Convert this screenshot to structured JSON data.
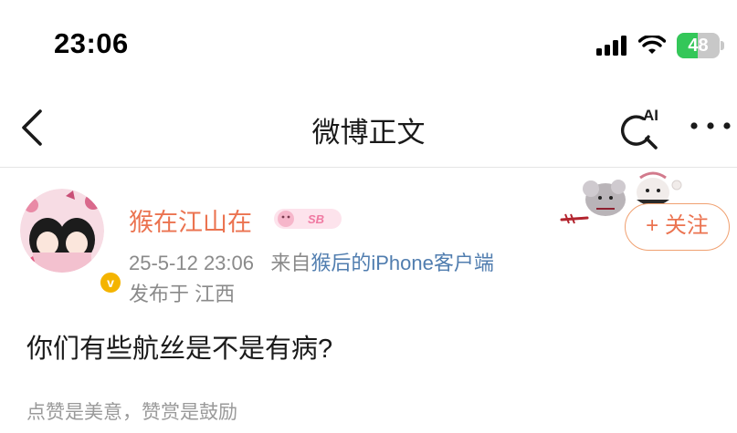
{
  "status_bar": {
    "time": "23:06",
    "battery_level": 48,
    "battery_label": "48",
    "icons": [
      "cellular-signal-icon",
      "wifi-icon",
      "battery-charging-icon"
    ]
  },
  "nav": {
    "title": "微博正文",
    "back_icon": "chevron-left-icon",
    "ai_search_label": "AI",
    "more_icon": "more-dots-icon"
  },
  "post": {
    "author": {
      "name": "猴在江山在",
      "member_badge_text": "SB",
      "verified_icon": "verified-v-icon",
      "verified_glyph": "v"
    },
    "timestamp": "25-5-12 23:06",
    "source_prefix": "来自",
    "source": "猴后的iPhone客户端",
    "location": "发布于 江西",
    "follow_label": "+ 关注",
    "content": "你们有些航丝是不是有病?",
    "reward_hint": "点赞是美意，赞赏是鼓励"
  },
  "colors": {
    "username": "#eb7350",
    "link": "#507daf",
    "meta": "#8a8a8a",
    "battery_fill": "#34c759",
    "verified": "#f4b400"
  }
}
